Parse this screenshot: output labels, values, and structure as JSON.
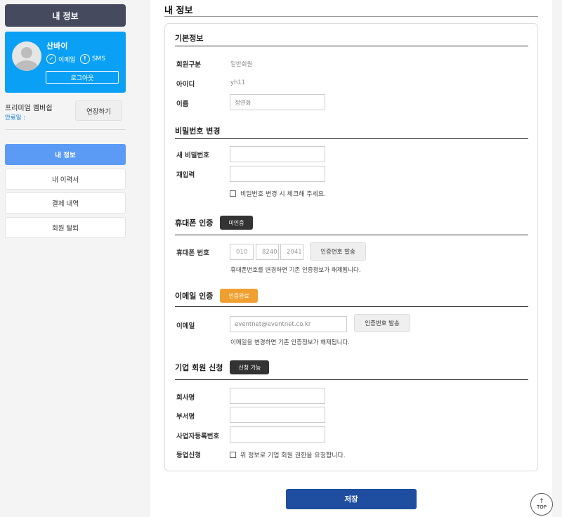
{
  "sidebar": {
    "header": "내 정보",
    "profile": {
      "name": "산바이",
      "email_badge": "이메일",
      "sms_badge": "SMS",
      "logout": "로그아웃"
    },
    "premium": {
      "label": "프리미엄 멤버쉽",
      "expiry": "만료일 :",
      "extend": "연장하기"
    },
    "nav": [
      {
        "label": "내 정보",
        "active": true
      },
      {
        "label": "내 이력서",
        "active": false
      },
      {
        "label": "결제 내역",
        "active": false
      },
      {
        "label": "회원 탈퇴",
        "active": false
      }
    ]
  },
  "main": {
    "title": "내 정보",
    "basic": {
      "title": "기본정보",
      "member_type_label": "회원구분",
      "member_type_value": "일반회원",
      "id_label": "아이디",
      "id_value": "yh11",
      "name_label": "이름",
      "name_value": "정연화"
    },
    "password": {
      "title": "비밀번호 변경",
      "new_label": "새 비밀번호",
      "confirm_label": "재입력",
      "check_text": "비밀번호 변경 시 체크해 주세요."
    },
    "phone": {
      "title": "휴대폰 인증",
      "status": "미인증",
      "label": "휴대폰 번호",
      "part1": "010",
      "part2": "8240",
      "part3": "2041",
      "send_btn": "인증번호 발송",
      "note": "휴대폰번호를 변경하면 기존 인증정보가 해제됩니다."
    },
    "email": {
      "title": "이메일 인증",
      "status": "인증완료",
      "label": "이메일",
      "value": "eventnet@eventnet.co.kr",
      "send_btn": "인증번호 발송",
      "note": "이메일을 변경하면 기존 인증정보가 해제됩니다."
    },
    "company": {
      "title": "기업 회원 신청",
      "status": "신청 가능",
      "company_label": "회사명",
      "dept_label": "부서명",
      "biz_label": "사업자등록번호",
      "apply_label": "등업신청",
      "apply_text": "위 정보로 기업 회원 권한을 요청합니다."
    },
    "save": "저장"
  },
  "top_button": "TOP",
  "colors": {
    "profile_card": "#0aa0f5",
    "nav_active": "#5b9bf5",
    "save_button": "#1f4ea1",
    "status_dark": "#333333",
    "status_orange": "#f0a030"
  }
}
